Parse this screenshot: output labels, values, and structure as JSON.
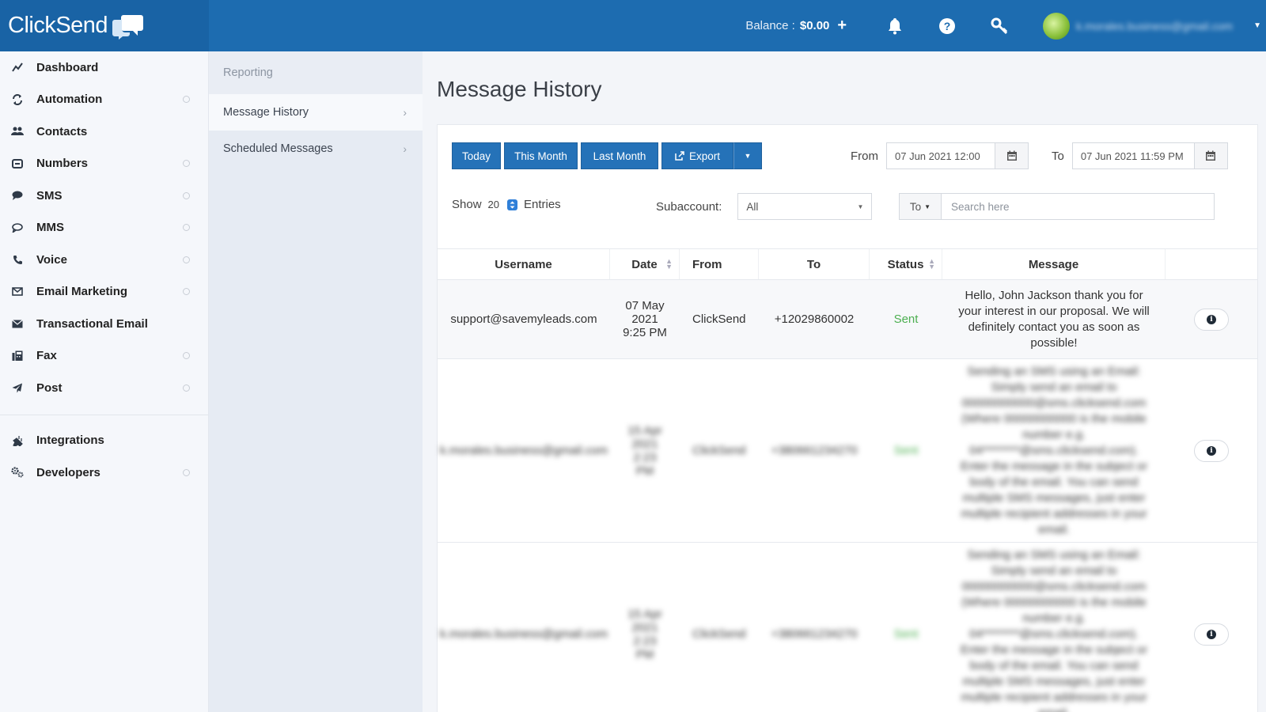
{
  "app": {
    "logo_text": "ClickSend",
    "balance_label": "Balance :",
    "balance_value": "$0.00",
    "user_email": "k.morales.business@gmail.com"
  },
  "sidebar": {
    "items": [
      {
        "label": "Dashboard",
        "icon": "chart-icon",
        "has_dot": false
      },
      {
        "label": "Automation",
        "icon": "refresh-icon",
        "has_dot": true
      },
      {
        "label": "Contacts",
        "icon": "users-icon",
        "has_dot": false
      },
      {
        "label": "Numbers",
        "icon": "hash-icon",
        "has_dot": true
      },
      {
        "label": "SMS",
        "icon": "chat-icon",
        "has_dot": true
      },
      {
        "label": "MMS",
        "icon": "chat-outline-icon",
        "has_dot": true
      },
      {
        "label": "Voice",
        "icon": "phone-icon",
        "has_dot": true
      },
      {
        "label": "Email Marketing",
        "icon": "envelope-outline-icon",
        "has_dot": true
      },
      {
        "label": "Transactional Email",
        "icon": "envelope-icon",
        "has_dot": false
      },
      {
        "label": "Fax",
        "icon": "fax-icon",
        "has_dot": true
      },
      {
        "label": "Post",
        "icon": "send-icon",
        "has_dot": true
      }
    ],
    "items2": [
      {
        "label": "Integrations",
        "icon": "plug-icon",
        "has_dot": false
      },
      {
        "label": "Developers",
        "icon": "cogs-icon",
        "has_dot": true
      }
    ]
  },
  "subnav": {
    "header": "Reporting",
    "items": [
      {
        "label": "Message History",
        "active": true
      },
      {
        "label": "Scheduled Messages",
        "active": false
      }
    ]
  },
  "main": {
    "title": "Message History",
    "buttons": {
      "today": "Today",
      "this_month": "This Month",
      "last_month": "Last Month",
      "export": "Export"
    },
    "from_label": "From",
    "from_value": "07 Jun 2021 12:00",
    "to_label": "To",
    "to_value": "07 Jun 2021 11:59 PM",
    "show_label": "Show",
    "show_value": "20",
    "entries_label": "Entries",
    "subaccount_label": "Subaccount:",
    "subaccount_value": "All",
    "search_filter": "To",
    "search_placeholder": "Search here"
  },
  "table": {
    "columns": [
      "Username",
      "Date",
      "From",
      "To",
      "Status",
      "Message"
    ],
    "rows": [
      {
        "username": "support@savemyleads.com",
        "date": "07 May 2021 9:25 PM",
        "from": "ClickSend",
        "to": "+12029860002",
        "status": "Sent",
        "message": "Hello, John Jackson thank you for your interest in our proposal. We will definitely contact you as soon as possible!"
      },
      {
        "username": "k.morales.business@gmail.com",
        "date": "15 Apr 2021 2:23 PM",
        "from": "ClickSend",
        "to": "+380661234270",
        "status": "Sent",
        "message": "Sending an SMS using an Email: Simply send an email to 00000000000@sms.clicksend.com (Where 00000000000 is the mobile number e.g. 04********@sms.clicksend.com). Enter the message in the subject or body of the email. You can send multiple SMS messages, just enter multiple recipient addresses in your email."
      },
      {
        "username": "k.morales.business@gmail.com",
        "date": "15 Apr 2021 2:23 PM",
        "from": "ClickSend",
        "to": "+380661234270",
        "status": "Sent",
        "message": "Sending an SMS using an Email: Simply send an email to 00000000000@sms.clicksend.com (Where 00000000000 is the mobile number e.g. 04********@sms.clicksend.com). Enter the message in the subject or body of the email. You can send multiple SMS messages, just enter multiple recipient addresses in your email."
      }
    ]
  }
}
